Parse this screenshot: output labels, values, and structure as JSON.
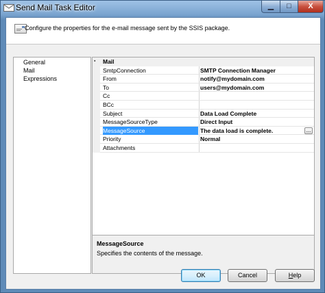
{
  "window": {
    "title": "Send Mail Task Editor",
    "close_label": "X"
  },
  "header": {
    "description": "Configure the properties for the e-mail message sent by the SSIS package."
  },
  "nav": {
    "items": [
      {
        "label": "General"
      },
      {
        "label": "Mail"
      },
      {
        "label": "Expressions"
      }
    ]
  },
  "grid": {
    "category": "Mail",
    "properties": [
      {
        "name": "SmtpConnection",
        "value": "SMTP Connection Manager"
      },
      {
        "name": "From",
        "value": "notify@mydomain.com"
      },
      {
        "name": "To",
        "value": "users@mydomain.com"
      },
      {
        "name": "Cc",
        "value": ""
      },
      {
        "name": "BCc",
        "value": ""
      },
      {
        "name": "Subject",
        "value": "Data Load Complete"
      },
      {
        "name": "MessageSourceType",
        "value": "Direct Input"
      },
      {
        "name": "MessageSource",
        "value": "The data load is complete.",
        "selected": true
      },
      {
        "name": "Priority",
        "value": "Normal"
      },
      {
        "name": "Attachments",
        "value": ""
      }
    ],
    "ellipsis": "..."
  },
  "help": {
    "title": "MessageSource",
    "description": "Specifies the contents of the message."
  },
  "buttons": {
    "ok": "OK",
    "cancel": "Cancel",
    "help_prefix": "",
    "help_underlined": "H",
    "help_rest": "elp"
  },
  "icons": {
    "app": "mail-task-icon",
    "header": "envelope-icon",
    "collapse": "collapse-toggle-icon"
  }
}
